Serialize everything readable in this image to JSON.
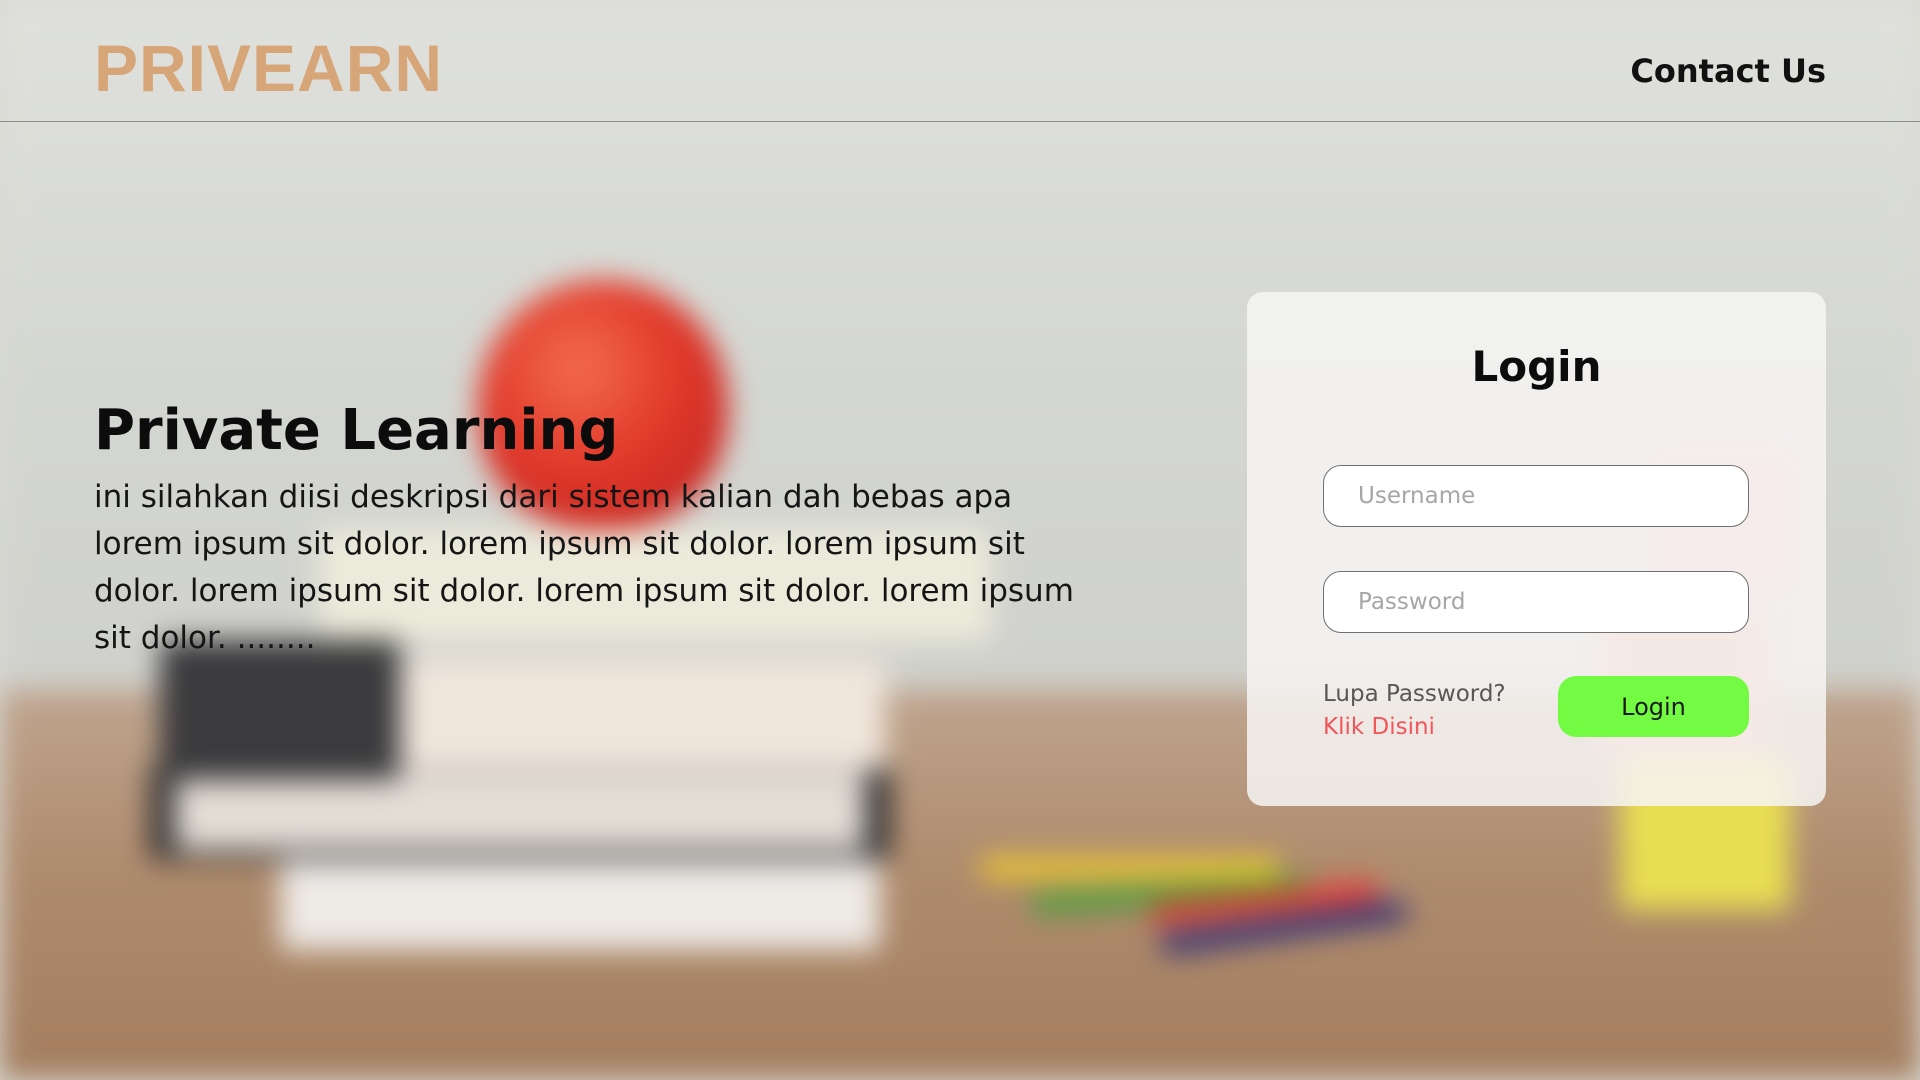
{
  "header": {
    "brand": "PRIVEARN",
    "contact_label": "Contact Us"
  },
  "hero": {
    "title": "Private Learning",
    "description": "ini silahkan diisi deskripsi dari sistem kalian dah bebas apa lorem ipsum sit dolor. lorem ipsum sit dolor. lorem ipsum sit dolor. lorem ipsum sit dolor. lorem ipsum sit dolor. lorem ipsum sit dolor. ........"
  },
  "login": {
    "title": "Login",
    "username_placeholder": "Username",
    "username_value": "",
    "password_placeholder": "Password",
    "password_value": "",
    "forgot_text": "Lupa Password?",
    "forgot_link": "Klik Disini",
    "submit_label": "Login"
  },
  "colors": {
    "brand": "#d7a678",
    "login_button": "#73fa42",
    "forgot_link": "#f0565a"
  }
}
